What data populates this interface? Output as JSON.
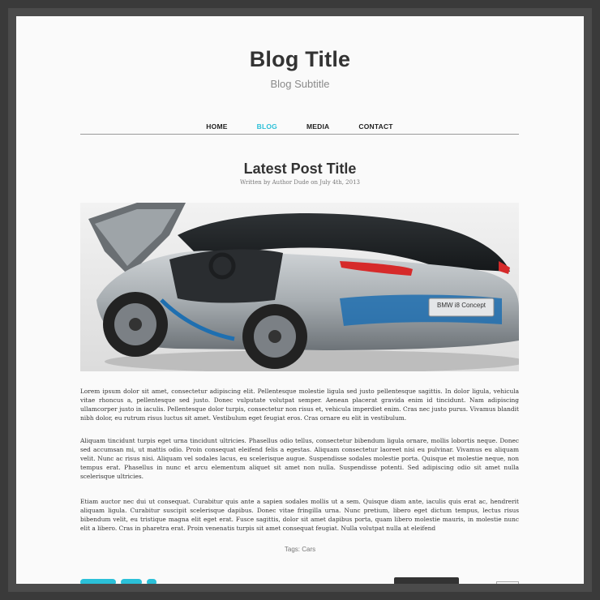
{
  "header": {
    "title": "Blog Title",
    "subtitle": "Blog Subtitle"
  },
  "nav": {
    "items": [
      {
        "label": "HOME",
        "active": false
      },
      {
        "label": "BLOG",
        "active": true
      },
      {
        "label": "MEDIA",
        "active": false
      },
      {
        "label": "CONTACT",
        "active": false
      }
    ]
  },
  "post": {
    "title": "Latest Post Title",
    "meta": "Written by Author Dude on July 4th, 2013",
    "image_badge": "BMW i8 Concept",
    "paragraphs": [
      "Lorem ipsum dolor sit amet, consectetur adipiscing elit. Pellentesque molestie ligula sed justo pellentesque sagittis. In dolor ligula, vehicula vitae rhoncus a, pellentesque sed justo. Donec vulputate volutpat semper. Aenean placerat gravida enim id tincidunt. Nam adipiscing ullamcorper justo in iaculis. Pellentesque dolor turpis, consectetur non risus et, vehicula imperdiet enim. Cras nec justo purus. Vivamus blandit nibh dolor, eu rutrum risus luctus sit amet. Vestibulum eget feugiat eros. Cras ornare eu elit in vestibulum.",
      "Aliquam tincidunt turpis eget urna tincidunt ultricies. Phasellus odio tellus, consectetur bibendum ligula ornare, mollis lobortis neque. Donec sed accumsan mi, ut mattis odio. Proin consequat eleifend felis a egestas. Aliquam consectetur laoreet nisi eu pulvinar. Vivamus eu aliquam velit. Nunc ac risus nisi. Aliquam vel sodales lacus, eu scelerisque augue. Suspendisse sodales molestie porta. Quisque et molestie neque, non tempus erat. Phasellus in nunc et arcu elementum aliquet sit amet non nulla. Suspendisse potenti. Sed adipiscing odio sit amet nulla scelerisque ultricies.",
      "Etiam auctor nec dui ut consequat. Curabitur quis ante a sapien sodales mollis ut a sem. Quisque diam ante, iaculis quis erat ac, hendrerit aliquam ligula. Curabitur suscipit scelerisque dapibus. Donec vitae fringilla urna. Nunc pretium, libero eget dictum tempus, lectus risus bibendum velit, eu tristique magna elit eget erat. Fusce sagittis, dolor sit amet dapibus porta, quam libero molestie mauris, in molestie nunc elit a libero. Cras in pharetra erat. Proin venenatis turpis sit amet consequat feugiat. Nulla volutpat nulla at eleifend"
    ],
    "tags_label": "Tags:",
    "tag": "Cars"
  },
  "colors": {
    "accent": "#2bc0d8",
    "text": "#333333",
    "page_bg": "#fafafa",
    "frame_bg": "#3a3a3a"
  }
}
